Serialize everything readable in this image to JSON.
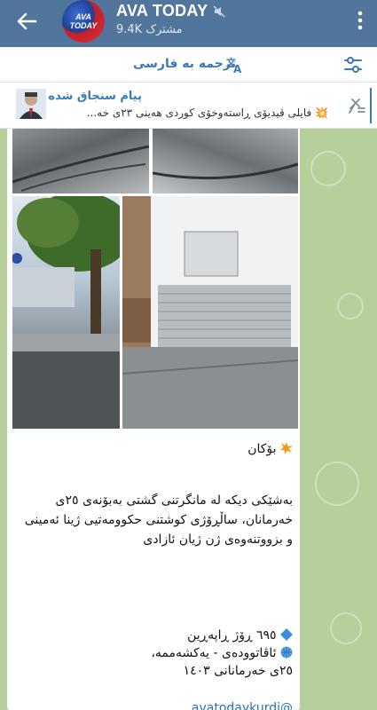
{
  "header": {
    "title": "AVA TODAY",
    "subscribers": "9.4K مشترک",
    "avatar_text": "AVA TODAY"
  },
  "translate_bar": {
    "label": "ترجمه به فارسی"
  },
  "pinned": {
    "title": "پیام سنجاق شده",
    "text": "💥 فایلی ڤیدیۆی ڕاسته‌وخۆی کوردی هه‌ینی ٢٣ی خه‌..."
  },
  "message": {
    "heading": "بۆکان",
    "paragraph": "به‌شێکی دیکه له مانگرتنی گشتی به‌بۆنه‌ی ٢٥ی خه‌رمانان، ساڵڕۆژی کوشتنی حکوومه‌تیی ژینا ئه‌مینی و بزووتنه‌وه‌ی ژن ژیان ئازادی",
    "day_line": "٦٩٥ ڕۆژ ڕاپه‌ڕین",
    "date_line1": "ئاڤاتووده‌ی - یه‌کشه‌ممه‌،",
    "date_line2": "٢٥ی خه‌رمانانی ١٤٠٣",
    "link": "@avatodaykurdi"
  },
  "colors": {
    "header_bg": "#52759c",
    "chat_bg": "#b7cf9a",
    "accent": "#3a79b6"
  }
}
